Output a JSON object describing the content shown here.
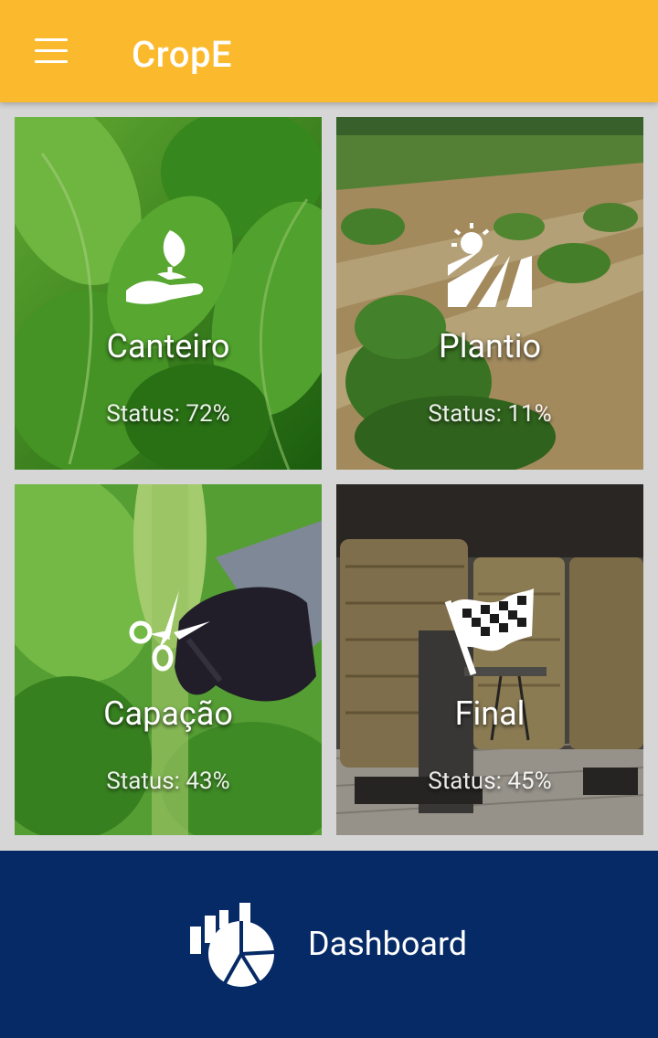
{
  "app": {
    "title": "CropE"
  },
  "tiles": [
    {
      "name": "Canteiro",
      "status_prefix": "Status:",
      "status_value": "72%",
      "icon": "seedling-hand-icon"
    },
    {
      "name": "Plantio",
      "status_prefix": "Status:",
      "status_value": "11%",
      "icon": "sun-field-icon"
    },
    {
      "name": "Capação",
      "status_prefix": "Status:",
      "status_value": "43%",
      "icon": "scissors-icon"
    },
    {
      "name": "Final",
      "status_prefix": "Status:",
      "status_value": "45%",
      "icon": "checkered-flag-icon"
    }
  ],
  "bottom": {
    "dashboard_label": "Dashboard",
    "icon": "pie-chart-icon"
  },
  "colors": {
    "appbar": "#FBBA2E",
    "bottombar": "#052A66",
    "background": "#D6D6D6"
  }
}
